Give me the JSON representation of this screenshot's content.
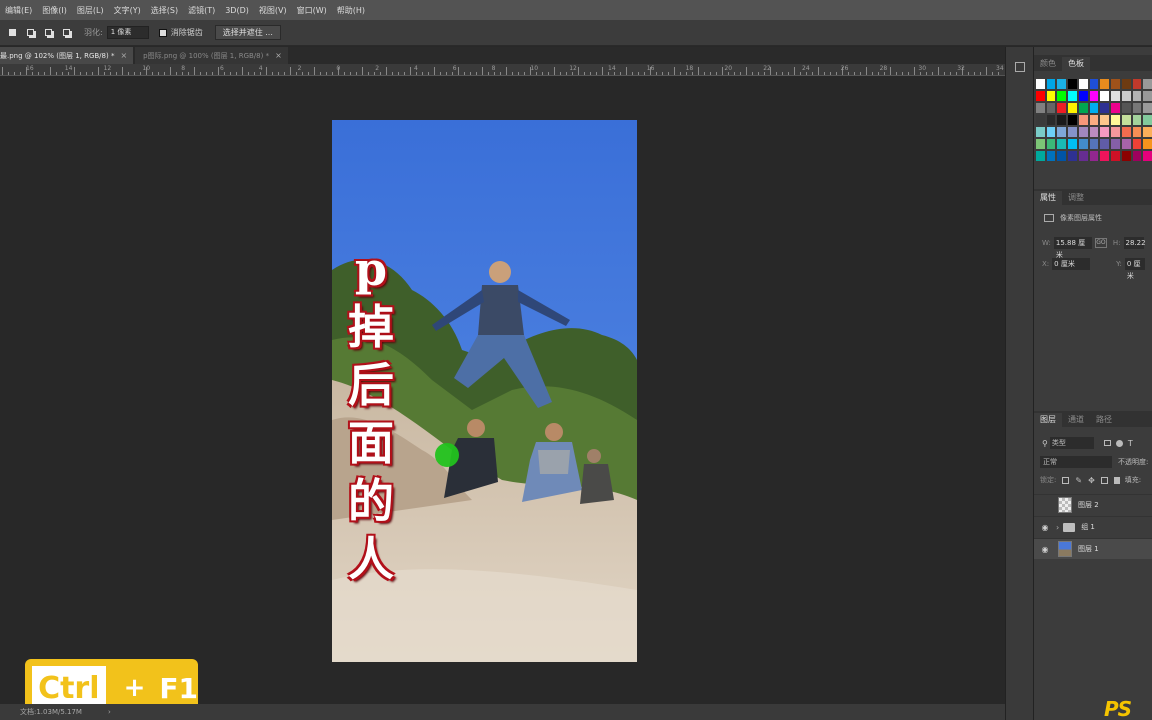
{
  "menu": [
    "编辑(E)",
    "图像(I)",
    "图层(L)",
    "文字(Y)",
    "选择(S)",
    "滤镜(T)",
    "3D(D)",
    "视图(V)",
    "窗口(W)",
    "帮助(H)"
  ],
  "options": {
    "feather_label": "羽化:",
    "feather_value": "1 像素",
    "antialias_label": "消除锯齿",
    "select_mask_button": "选择并遮住 ..."
  },
  "tabs": [
    {
      "label": "最.png @ 102% (图层 1, RGB/8) *",
      "close": "×"
    },
    {
      "label": "p图际.png @ 100% (图层 1, RGB/8) *",
      "close": "×"
    }
  ],
  "ruler_labels": [
    "16",
    "14",
    "12",
    "10",
    "8",
    "6",
    "4",
    "2",
    "0",
    "2",
    "4",
    "6",
    "8",
    "10",
    "12",
    "14",
    "16",
    "18",
    "20",
    "22",
    "24",
    "26",
    "28",
    "30",
    "32",
    "34"
  ],
  "overlay_text": [
    "p",
    "掉",
    "后",
    "面",
    "的",
    "人"
  ],
  "shortcut": {
    "key1": "Ctrl",
    "plus": "+",
    "key2": "F1"
  },
  "status": {
    "doc": "文档:1.03M/5.17M",
    "arrow": "›"
  },
  "panels": {
    "color_tabs": [
      "颜色",
      "色板"
    ],
    "props_tabs": [
      "属性",
      "调整"
    ],
    "props_title": "像素图层属性",
    "w_label": "W:",
    "w_value": "15.88 厘米",
    "link": "GO",
    "h_label": "H:",
    "h_value": "28.22",
    "x_label": "X:",
    "x_value": "0 厘米",
    "y_label": "Y:",
    "y_value": "0 厘米",
    "layer_tabs": [
      "图层",
      "通道",
      "路径"
    ],
    "filter_kind": "类型",
    "blend_mode": "正常",
    "opacity_label": "不透明度:",
    "lock_label": "锁定:",
    "fill_label": "填充:",
    "layers": [
      {
        "name": "图层 2",
        "visible": false
      },
      {
        "name": "组 1",
        "visible": true
      },
      {
        "name": "图层 1",
        "visible": true
      }
    ]
  },
  "swatch_colors": [
    [
      "#ffffff",
      "#00a6e6",
      "#1bb1e6",
      "#000000",
      "#ffffff",
      "#1e4fd8",
      "#e88b1e",
      "#a0521a",
      "#6e3b12",
      "#c0392b",
      "#999999"
    ],
    [
      "#ff0000",
      "#ffff00",
      "#00ff00",
      "#00ffff",
      "#0000ff",
      "#ff00ff",
      "#ffffff",
      "#e0e0e0",
      "#cccccc",
      "#b3b3b3",
      "#999999"
    ],
    [
      "#808080",
      "#666666",
      "#ee1d24",
      "#fff200",
      "#00a651",
      "#00aeef",
      "#2e3192",
      "#ec008c",
      "#555555",
      "#777777",
      "#9a9a9a"
    ],
    [
      "#3a3a3a",
      "#2a2a2a",
      "#1a1a1a",
      "#000000",
      "#f7977a",
      "#fbad82",
      "#fdc68c",
      "#fff799",
      "#c4df9b",
      "#a3d39c",
      "#82ca9c"
    ],
    [
      "#7accc8",
      "#6dcff6",
      "#7ea7d8",
      "#8493ca",
      "#a187be",
      "#bc8cbf",
      "#f49ac1",
      "#f5989d",
      "#f26c4f",
      "#f68e55",
      "#fbaf5a"
    ],
    [
      "#7cc576",
      "#3bb878",
      "#1abbb4",
      "#00bff3",
      "#438ccb",
      "#5574b9",
      "#605ca8",
      "#855fa8",
      "#a763a9",
      "#ef4136",
      "#f7941d"
    ],
    [
      "#00a99d",
      "#0072bc",
      "#0054a6",
      "#2e3192",
      "#662d91",
      "#92278f",
      "#ed145b",
      "#ce1126",
      "#8b0000",
      "#9e005d",
      "#e4007c"
    ]
  ]
}
